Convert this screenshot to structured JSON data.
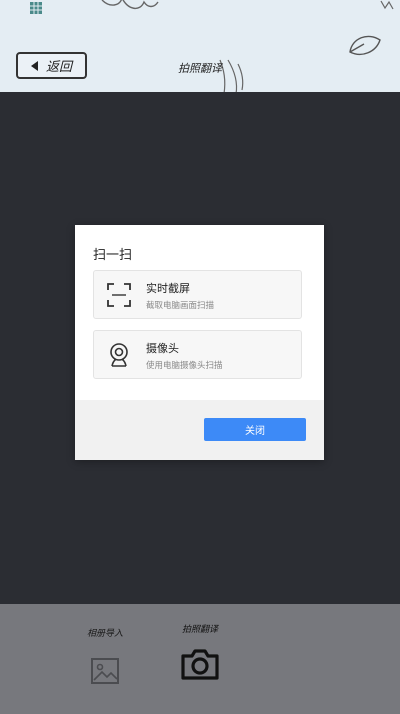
{
  "header": {
    "back_label": "返回",
    "title": "拍照翻译"
  },
  "modal": {
    "title": "扫一扫",
    "options": [
      {
        "title": "实时截屏",
        "desc": "截取电脑画面扫描",
        "icon": "screenshot-frame-icon"
      },
      {
        "title": "摄像头",
        "desc": "使用电脑摄像头扫描",
        "icon": "webcam-icon"
      }
    ],
    "close_label": "关闭"
  },
  "bottom_bar": {
    "import_label": "相册导入",
    "import_icon": "image-icon",
    "photo_label": "拍照翻译",
    "photo_icon": "camera-icon"
  },
  "colors": {
    "primary_button": "#3d8af7",
    "overlay_dark": "#2b2d33"
  }
}
